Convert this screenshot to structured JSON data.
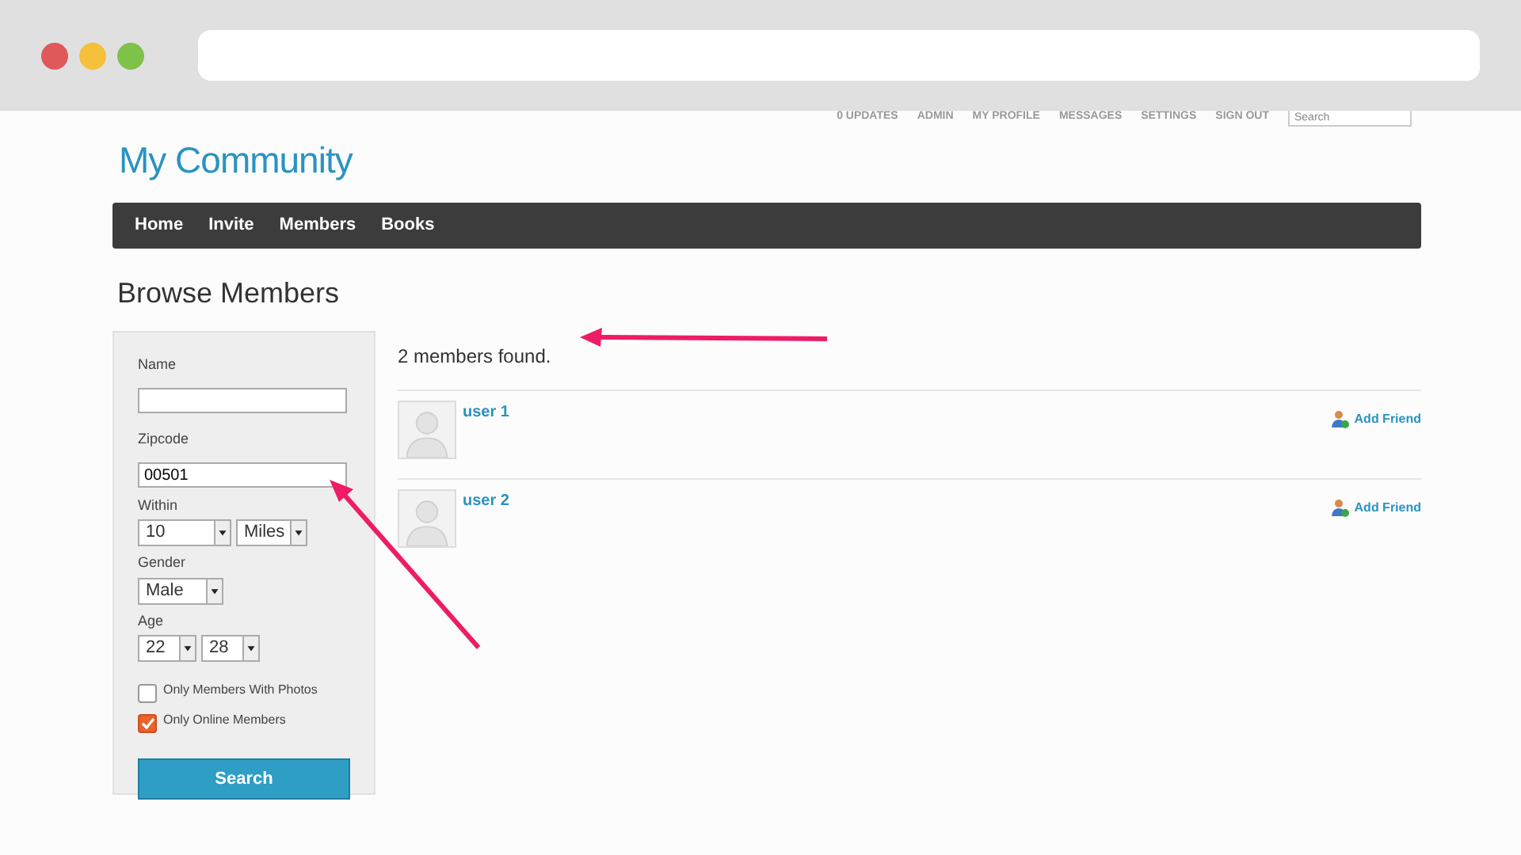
{
  "top_links": [
    "0 UPDATES",
    "ADMIN",
    "MY PROFILE",
    "MESSAGES",
    "SETTINGS",
    "SIGN OUT"
  ],
  "top_search": {
    "placeholder": "Search"
  },
  "site_title": "My Community",
  "nav": [
    "Home",
    "Invite",
    "Members",
    "Books"
  ],
  "page_title": "Browse Members",
  "form": {
    "name": {
      "label": "Name"
    },
    "zipcode": {
      "label": "Zipcode",
      "value": "00501"
    },
    "within": {
      "label": "Within",
      "distance": "10",
      "unit": "Miles"
    },
    "gender": {
      "label": "Gender",
      "value": "Male"
    },
    "age": {
      "label": "Age",
      "from": "22",
      "to": "28"
    },
    "checkboxes": [
      {
        "label": "Only Members With Photos",
        "checked": false
      },
      {
        "label": "Only Online Members",
        "checked": true
      }
    ],
    "submit": "Search"
  },
  "result_count": "2 members found.",
  "members": [
    {
      "name": "user 1",
      "action": "Add Friend"
    },
    {
      "name": "user 2",
      "action": "Add Friend"
    }
  ]
}
